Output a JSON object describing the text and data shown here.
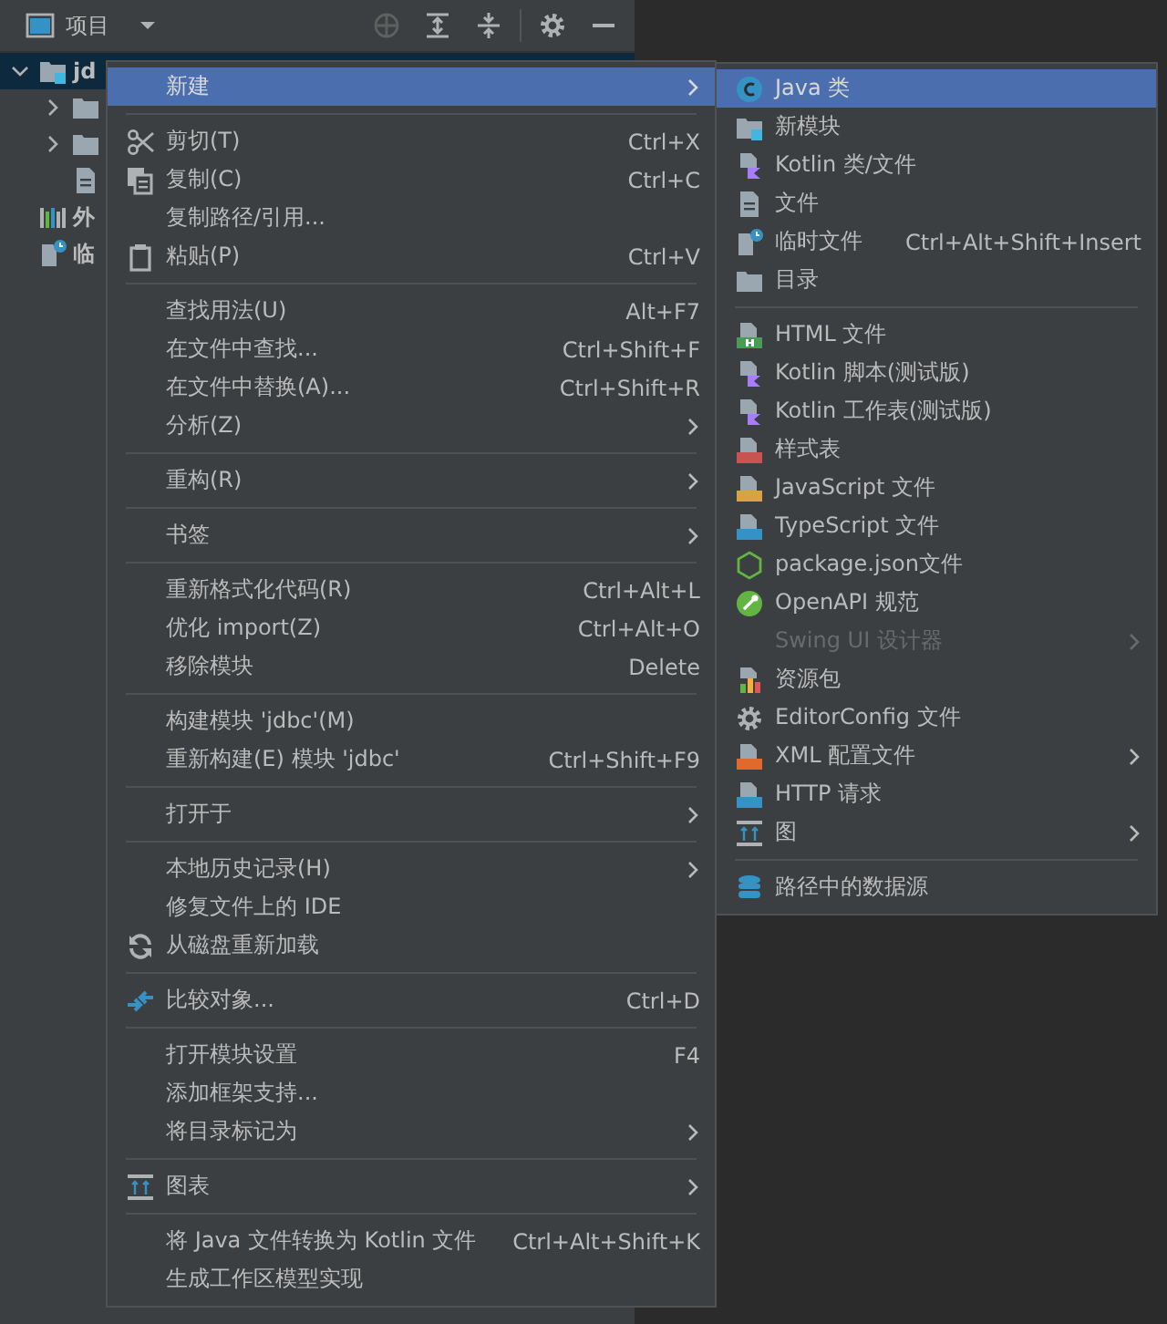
{
  "panel": {
    "title": "项目"
  },
  "tree": [
    {
      "label": "jd",
      "kind": "module",
      "expanded": true,
      "selected": true,
      "children": [
        {
          "kind": "folder",
          "expanded": false,
          "selected": false
        },
        {
          "kind": "folder",
          "expanded": false,
          "selected": false
        },
        {
          "kind": "file",
          "selected": false
        }
      ]
    },
    {
      "label": "外",
      "kind": "library",
      "selected": false
    },
    {
      "label": "临",
      "kind": "scratch",
      "selected": false
    }
  ],
  "context_menu": [
    {
      "kind": "text",
      "label": "新建",
      "submenu": true,
      "selected": true
    },
    {
      "kind": "separator"
    },
    {
      "kind": "scissors",
      "label": "剪切(T)",
      "shortcut": "Ctrl+X",
      "selected": false
    },
    {
      "kind": "copy",
      "label": "复制(C)",
      "shortcut": "Ctrl+C",
      "selected": false
    },
    {
      "kind": "text",
      "label": "复制路径/引用...",
      "selected": false
    },
    {
      "kind": "paste",
      "label": "粘贴(P)",
      "shortcut": "Ctrl+V",
      "selected": false
    },
    {
      "kind": "separator"
    },
    {
      "kind": "text",
      "label": "查找用法(U)",
      "shortcut": "Alt+F7",
      "selected": false
    },
    {
      "kind": "text",
      "label": "在文件中查找...",
      "shortcut": "Ctrl+Shift+F",
      "selected": false
    },
    {
      "kind": "text",
      "label": "在文件中替换(A)...",
      "shortcut": "Ctrl+Shift+R",
      "selected": false
    },
    {
      "kind": "text",
      "label": "分析(Z)",
      "submenu": true,
      "selected": false
    },
    {
      "kind": "separator"
    },
    {
      "kind": "text",
      "label": "重构(R)",
      "submenu": true,
      "selected": false
    },
    {
      "kind": "separator"
    },
    {
      "kind": "text",
      "label": "书签",
      "submenu": true,
      "selected": false
    },
    {
      "kind": "separator"
    },
    {
      "kind": "text",
      "label": "重新格式化代码(R)",
      "shortcut": "Ctrl+Alt+L",
      "selected": false
    },
    {
      "kind": "text",
      "label": "优化 import(Z)",
      "shortcut": "Ctrl+Alt+O",
      "selected": false
    },
    {
      "kind": "text",
      "label": "移除模块",
      "shortcut": "Delete",
      "selected": false
    },
    {
      "kind": "separator"
    },
    {
      "kind": "text",
      "label": "构建模块 'jdbc'(M)",
      "selected": false
    },
    {
      "kind": "text",
      "label": "重新构建(E) 模块 'jdbc'",
      "shortcut": "Ctrl+Shift+F9",
      "selected": false
    },
    {
      "kind": "separator"
    },
    {
      "kind": "text",
      "label": "打开于",
      "submenu": true,
      "selected": false
    },
    {
      "kind": "separator"
    },
    {
      "kind": "text",
      "label": "本地历史记录(H)",
      "submenu": true,
      "selected": false
    },
    {
      "kind": "text",
      "label": "修复文件上的 IDE",
      "selected": false
    },
    {
      "kind": "reload",
      "label": "从磁盘重新加载",
      "selected": false
    },
    {
      "kind": "separator"
    },
    {
      "kind": "compare",
      "label": "比较对象...",
      "shortcut": "Ctrl+D",
      "selected": false
    },
    {
      "kind": "separator"
    },
    {
      "kind": "text",
      "label": "打开模块设置",
      "shortcut": "F4",
      "selected": false
    },
    {
      "kind": "text",
      "label": "添加框架支持...",
      "selected": false
    },
    {
      "kind": "text",
      "label": "将目录标记为",
      "submenu": true,
      "selected": false
    },
    {
      "kind": "separator"
    },
    {
      "kind": "diagram",
      "label": "图表",
      "submenu": true,
      "selected": false
    },
    {
      "kind": "separator"
    },
    {
      "kind": "text",
      "label": "将 Java 文件转换为 Kotlin 文件",
      "shortcut": "Ctrl+Alt+Shift+K",
      "selected": false
    },
    {
      "kind": "text",
      "label": "生成工作区模型实现",
      "selected": false
    }
  ],
  "new_submenu": [
    {
      "kind": "java",
      "label": "Java 类",
      "selected": true
    },
    {
      "kind": "module",
      "label": "新模块",
      "selected": false
    },
    {
      "kind": "kotlin",
      "label": "Kotlin 类/文件",
      "selected": false
    },
    {
      "kind": "file",
      "label": "文件",
      "selected": false
    },
    {
      "kind": "scratch",
      "label": "临时文件",
      "shortcut": "Ctrl+Alt+Shift+Insert",
      "selected": false
    },
    {
      "kind": "folder",
      "label": "目录",
      "selected": false
    },
    {
      "kind": "separator"
    },
    {
      "kind": "html",
      "label": "HTML 文件",
      "selected": false
    },
    {
      "kind": "kotlin",
      "label": "Kotlin 脚本(测试版)",
      "selected": false
    },
    {
      "kind": "kotlin",
      "label": "Kotlin 工作表(测试版)",
      "selected": false
    },
    {
      "kind": "css",
      "label": "样式表",
      "selected": false
    },
    {
      "kind": "js",
      "label": "JavaScript 文件",
      "selected": false
    },
    {
      "kind": "ts",
      "label": "TypeScript 文件",
      "selected": false
    },
    {
      "kind": "node",
      "label": "package.json文件",
      "selected": false
    },
    {
      "kind": "openapi",
      "label": "OpenAPI 规范",
      "selected": false
    },
    {
      "kind": "text",
      "label": "Swing UI 设计器",
      "submenu": true,
      "disabled": true,
      "selected": false
    },
    {
      "kind": "bundle",
      "label": "资源包",
      "selected": false
    },
    {
      "kind": "gear",
      "label": "EditorConfig 文件",
      "selected": false
    },
    {
      "kind": "xml",
      "label": "XML 配置文件",
      "submenu": true,
      "selected": false
    },
    {
      "kind": "api",
      "label": "HTTP 请求",
      "selected": false
    },
    {
      "kind": "diagram",
      "label": "图",
      "submenu": true,
      "selected": false
    },
    {
      "kind": "separator"
    },
    {
      "kind": "database",
      "label": "路径中的数据源",
      "selected": false
    }
  ]
}
